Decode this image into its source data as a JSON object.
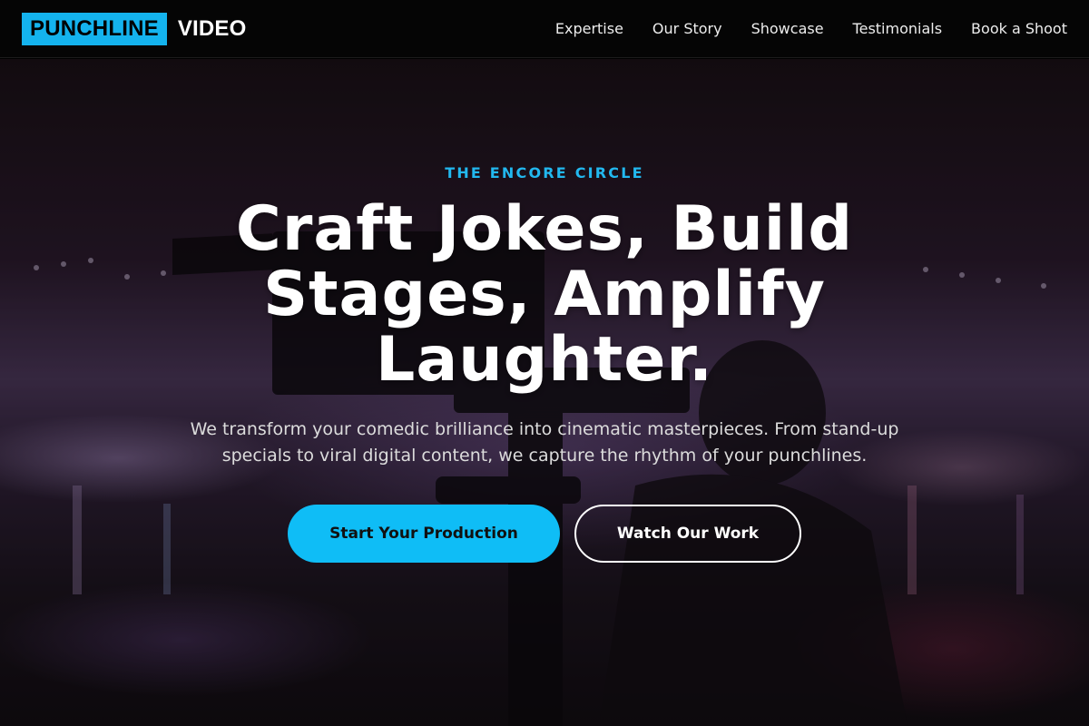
{
  "brand": {
    "highlight": "PUNCHLINE",
    "suffix": "VIDEO",
    "accent_color": "#14b3ee"
  },
  "nav": {
    "links": [
      {
        "label": "Expertise"
      },
      {
        "label": "Our Story"
      },
      {
        "label": "Showcase"
      },
      {
        "label": "Testimonials"
      },
      {
        "label": "Book a Shoot"
      }
    ]
  },
  "hero": {
    "eyebrow": "THE ENCORE CIRCLE",
    "headline_lines": [
      "Craft Jokes, Build",
      "Stages, Amplify",
      "Laughter."
    ],
    "subtext_lines": [
      "We transform your comedic brilliance into cinematic masterpieces. From stand-up",
      "specials to viral digital content, we capture the rhythm of your punchlines."
    ],
    "primary_cta": "Start Your Production",
    "secondary_cta": "Watch Our Work",
    "background_image": "camera-operator-event-photo"
  }
}
